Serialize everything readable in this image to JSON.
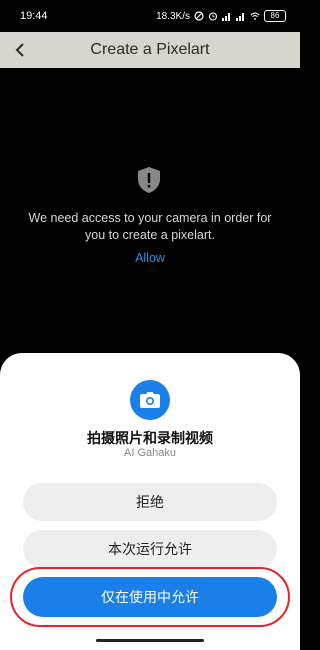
{
  "status": {
    "time": "19:44",
    "network_speed": "18.3K/s",
    "battery": "86"
  },
  "appbar": {
    "title": "Create a Pixelart"
  },
  "content": {
    "message": "We need access to your camera in order for you to create a pixelart.",
    "allow_label": "Allow"
  },
  "dialog": {
    "title": "拍摄照片和录制视频",
    "app_name": "AI Gahaku",
    "deny_label": "拒绝",
    "once_label": "本次运行允许",
    "while_using_label": "仅在使用中允许"
  },
  "colors": {
    "accent": "#1a7fe8",
    "appbar_bg": "#d8d4ce",
    "annotation": "#e8262a"
  }
}
